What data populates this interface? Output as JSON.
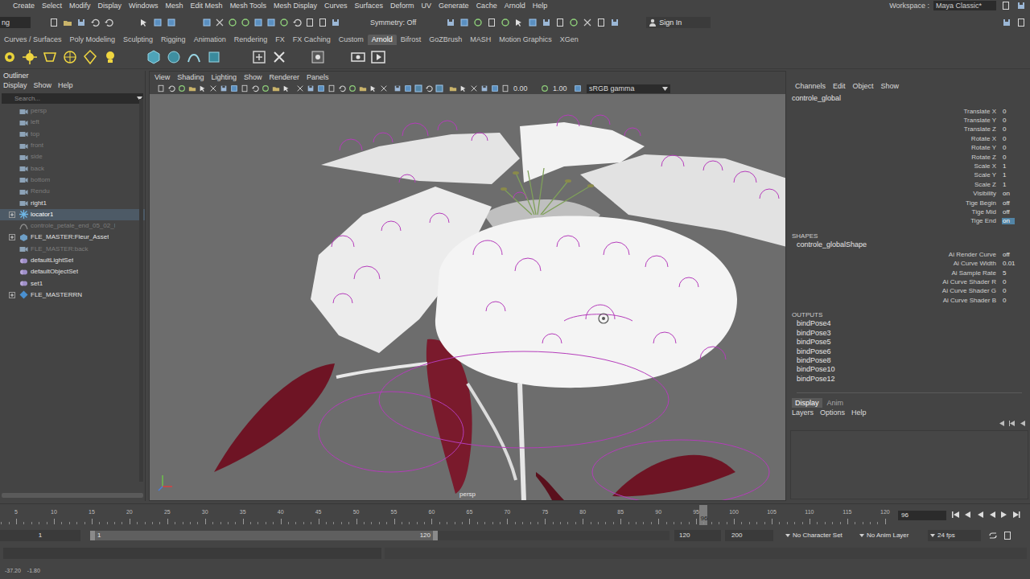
{
  "menu_bar": {
    "items": [
      "Create",
      "Select",
      "Modify",
      "Display",
      "Windows",
      "Mesh",
      "Edit Mesh",
      "Mesh Tools",
      "Mesh Display",
      "Curves",
      "Surfaces",
      "Deform",
      "UV",
      "Generate",
      "Cache",
      "Arnold",
      "Help"
    ],
    "workspace_label": "Workspace :",
    "workspace": "Maya Classic*"
  },
  "status_line": {
    "mode": "ng",
    "symmetry": "Symmetry: Off",
    "sign_in": "Sign In"
  },
  "shelf": {
    "tabs": [
      {
        "label": "Curves / Surfaces",
        "selected": false
      },
      {
        "label": "Poly Modeling",
        "selected": false
      },
      {
        "label": "Sculpting",
        "selected": false
      },
      {
        "label": "Rigging",
        "selected": false
      },
      {
        "label": "Animation",
        "selected": false
      },
      {
        "label": "Rendering",
        "selected": false
      },
      {
        "label": "FX",
        "selected": false
      },
      {
        "label": "FX Caching",
        "selected": false
      },
      {
        "label": "Custom",
        "selected": false
      },
      {
        "label": "Arnold",
        "selected": true
      },
      {
        "label": "Bifrost",
        "selected": false
      },
      {
        "label": "GoZBrush",
        "selected": false
      },
      {
        "label": "MASH",
        "selected": false
      },
      {
        "label": "Motion Graphics",
        "selected": false
      },
      {
        "label": "XGen",
        "selected": false
      }
    ]
  },
  "outliner": {
    "title": "Outliner",
    "menu": [
      "Display",
      "Show",
      "Help"
    ],
    "search_placeholder": "Search...",
    "items": [
      {
        "label": "persp",
        "kind": "camera",
        "selected": false,
        "dimmed": true,
        "expandable": false
      },
      {
        "label": "left",
        "kind": "camera",
        "selected": false,
        "dimmed": true,
        "expandable": false
      },
      {
        "label": "top",
        "kind": "camera",
        "selected": false,
        "dimmed": true,
        "expandable": false
      },
      {
        "label": "front",
        "kind": "camera",
        "selected": false,
        "dimmed": true,
        "expandable": false
      },
      {
        "label": "side",
        "kind": "camera",
        "selected": false,
        "dimmed": true,
        "expandable": false
      },
      {
        "label": "back",
        "kind": "camera",
        "selected": false,
        "dimmed": true,
        "expandable": false
      },
      {
        "label": "bottom",
        "kind": "camera",
        "selected": false,
        "dimmed": true,
        "expandable": false
      },
      {
        "label": "Rendu",
        "kind": "camera",
        "selected": false,
        "dimmed": true,
        "expandable": false
      },
      {
        "label": "right1",
        "kind": "camera",
        "selected": false,
        "dimmed": false,
        "expandable": false
      },
      {
        "label": "locator1",
        "kind": "locator",
        "selected": true,
        "dimmed": false,
        "expandable": true
      },
      {
        "label": "controle_petale_end_05_02_l",
        "kind": "curve",
        "selected": false,
        "dimmed": true,
        "expandable": false
      },
      {
        "label": "FLE_MASTER:Fleur_Asset",
        "kind": "transform",
        "selected": false,
        "dimmed": false,
        "expandable": true
      },
      {
        "label": "FLE_MASTER:back",
        "kind": "camera",
        "selected": false,
        "dimmed": true,
        "expandable": false
      },
      {
        "label": "defaultLightSet",
        "kind": "set",
        "selected": false,
        "dimmed": false,
        "expandable": false
      },
      {
        "label": "defaultObjectSet",
        "kind": "set",
        "selected": false,
        "dimmed": false,
        "expandable": false
      },
      {
        "label": "set1",
        "kind": "set",
        "selected": false,
        "dimmed": false,
        "expandable": false
      },
      {
        "label": "FLE_MASTERRN",
        "kind": "reference",
        "selected": false,
        "dimmed": false,
        "expandable": true
      }
    ]
  },
  "viewport": {
    "menu": [
      "View",
      "Shading",
      "Lighting",
      "Show",
      "Renderer",
      "Panels"
    ],
    "exposure": "0.00",
    "gamma": "1.00",
    "color_space": "sRGB gamma",
    "camera": "persp"
  },
  "channel_box": {
    "menu": [
      "Channels",
      "Edit",
      "Object",
      "Show"
    ],
    "node": "controle_global",
    "attributes": [
      {
        "name": "Translate X",
        "value": "0",
        "selected": false
      },
      {
        "name": "Translate Y",
        "value": "0",
        "selected": false
      },
      {
        "name": "Translate Z",
        "value": "0",
        "selected": false
      },
      {
        "name": "Rotate X",
        "value": "0",
        "selected": false
      },
      {
        "name": "Rotate Y",
        "value": "0",
        "selected": false
      },
      {
        "name": "Rotate Z",
        "value": "0",
        "selected": false
      },
      {
        "name": "Scale X",
        "value": "1",
        "selected": false
      },
      {
        "name": "Scale Y",
        "value": "1",
        "selected": false
      },
      {
        "name": "Scale Z",
        "value": "1",
        "selected": false
      },
      {
        "name": "Visibility",
        "value": "on",
        "selected": false
      },
      {
        "name": "Tige Begin",
        "value": "off",
        "selected": false
      },
      {
        "name": "Tige Mid",
        "value": "off",
        "selected": false
      },
      {
        "name": "Tige End",
        "value": "on",
        "selected": true
      }
    ],
    "shapes_header": "SHAPES",
    "shape": "controle_globalShape",
    "shape_attributes": [
      {
        "name": "Ai Render Curve",
        "value": "off"
      },
      {
        "name": "Ai Curve Width",
        "value": "0.01"
      },
      {
        "name": "Ai Sample Rate",
        "value": "5"
      },
      {
        "name": "Ai Curve Shader R",
        "value": "0"
      },
      {
        "name": "Ai Curve Shader G",
        "value": "0"
      },
      {
        "name": "Ai Curve Shader B",
        "value": "0"
      }
    ],
    "outputs_header": "OUTPUTS",
    "outputs": [
      "bindPose4",
      "bindPose3",
      "bindPose5",
      "bindPose6",
      "bindPose8",
      "bindPose10",
      "bindPose12"
    ]
  },
  "layer_editor": {
    "tabs": [
      {
        "label": "Display",
        "selected": true
      },
      {
        "label": "Anim",
        "selected": false
      }
    ],
    "menu": [
      "Layers",
      "Options",
      "Help"
    ]
  },
  "time_slider": {
    "ticks": [
      "5",
      "10",
      "15",
      "20",
      "25",
      "30",
      "35",
      "40",
      "45",
      "50",
      "55",
      "60",
      "65",
      "70",
      "75",
      "80",
      "85",
      "90",
      "95",
      "100",
      "105",
      "110",
      "115",
      "120"
    ],
    "current_frame": "96",
    "frame_field": "96"
  },
  "range_slider": {
    "start_field": "1",
    "range_start": "1",
    "range_end": "120",
    "end_field": "120",
    "max_field": "200",
    "level": 0.6,
    "character_set": "No Character Set",
    "anim_layer": "No Anim Layer",
    "fps": "24 fps"
  },
  "help_line": {
    "coords": [
      "-37.20",
      "-1.80"
    ]
  }
}
